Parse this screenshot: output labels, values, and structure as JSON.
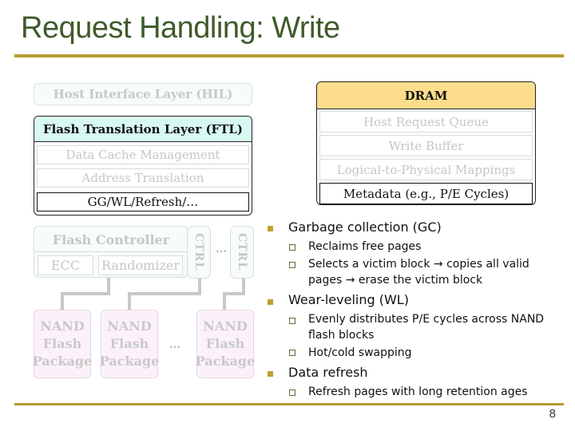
{
  "slide": {
    "title": "Request Handling: Write",
    "page_number": "8"
  },
  "diagram": {
    "hil": "Host Interface Layer (HIL)",
    "ftl": {
      "header": "Flash Translation Layer (FTL)",
      "rows": [
        "Data Cache Management",
        "Address Translation",
        "GG/WL/Refresh/…"
      ]
    },
    "dram": {
      "header": "DRAM",
      "rows": [
        "Host Request Queue",
        "Write Buffer",
        "Logical-to-Physical Mappings",
        "Metadata (e.g., P/E Cycles)"
      ]
    },
    "flash_controller": {
      "title": "Flash Controller",
      "ecc": "ECC",
      "randomizer": "Randomizer"
    },
    "ctrl_label": "CTRL",
    "ellipsis": "…",
    "nand": [
      "NAND Flash Package",
      "NAND Flash Package",
      "NAND Flash Package"
    ],
    "nand_lines": [
      "NAND",
      "Flash",
      "Package"
    ]
  },
  "bullets": [
    {
      "text": "Garbage collection (GC)",
      "sub": [
        "Reclaims free pages",
        "Selects a victim block → copies all valid pages → erase the victim block"
      ]
    },
    {
      "text": "Wear-leveling (WL)",
      "sub": [
        "Evenly distributes P/E cycles across NAND flash blocks",
        "Hot/cold swapping"
      ]
    },
    {
      "text": "Data refresh",
      "sub": [
        "Refresh pages with long retention ages"
      ]
    }
  ],
  "colors": {
    "title": "#3f5a2b",
    "rule": "#b89a30",
    "ftl_header": "#d8f8f2",
    "dram_header": "#fbdd8c",
    "nand_fill": "#fcf1fa"
  }
}
